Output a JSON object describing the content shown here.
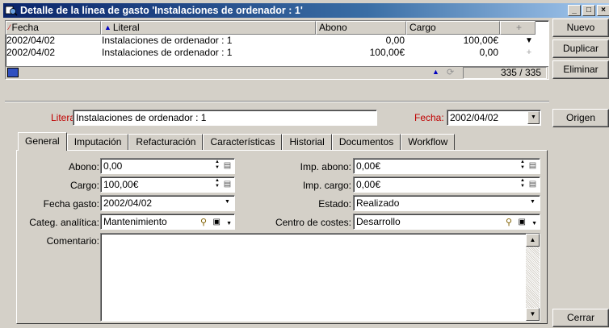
{
  "window": {
    "title": "Detalle de la línea de gasto 'Instalaciones de ordenador : 1'",
    "controls": [
      "_",
      "□",
      "×"
    ]
  },
  "grid": {
    "columns": [
      "Fecha",
      "Literal",
      "Abono",
      "Cargo"
    ],
    "rows": [
      {
        "fecha": "2002/04/02",
        "literal": "Instalaciones de ordenador : 1",
        "abono": "0,00",
        "cargo": "100,00€"
      },
      {
        "fecha": "2002/04/02",
        "literal": "Instalaciones de ordenador : 1",
        "abono": "100,00€",
        "cargo": "0,00"
      }
    ],
    "counter": "335 / 335"
  },
  "buttons": {
    "nuevo": "Nuevo",
    "duplicar": "Duplicar",
    "eliminar": "Eliminar",
    "origen": "Origen",
    "cerrar": "Cerrar"
  },
  "header_fields": {
    "literal_label": "Literal:",
    "literal_value": "Instalaciones de ordenador : 1",
    "fecha_label": "Fecha:",
    "fecha_value": "2002/04/02"
  },
  "tabs": [
    "General",
    "Imputación",
    "Refacturación",
    "Características",
    "Historial",
    "Documentos",
    "Workflow"
  ],
  "active_tab": "General",
  "form": {
    "abono_label": "Abono:",
    "abono_value": "0,00",
    "cargo_label": "Cargo:",
    "cargo_value": "100,00€",
    "fecha_gasto_label": "Fecha gasto:",
    "fecha_gasto_value": "2002/04/02",
    "categ_label": "Categ. analítica:",
    "categ_value": "Mantenimiento",
    "comentario_label": "Comentario:",
    "imp_abono_label": "Imp. abono:",
    "imp_abono_value": "0,00€",
    "imp_cargo_label": "Imp. cargo:",
    "imp_cargo_value": "0,00€",
    "estado_label": "Estado:",
    "estado_value": "Realizado",
    "centro_label": "Centro de costes:",
    "centro_value": "Desarrollo"
  }
}
